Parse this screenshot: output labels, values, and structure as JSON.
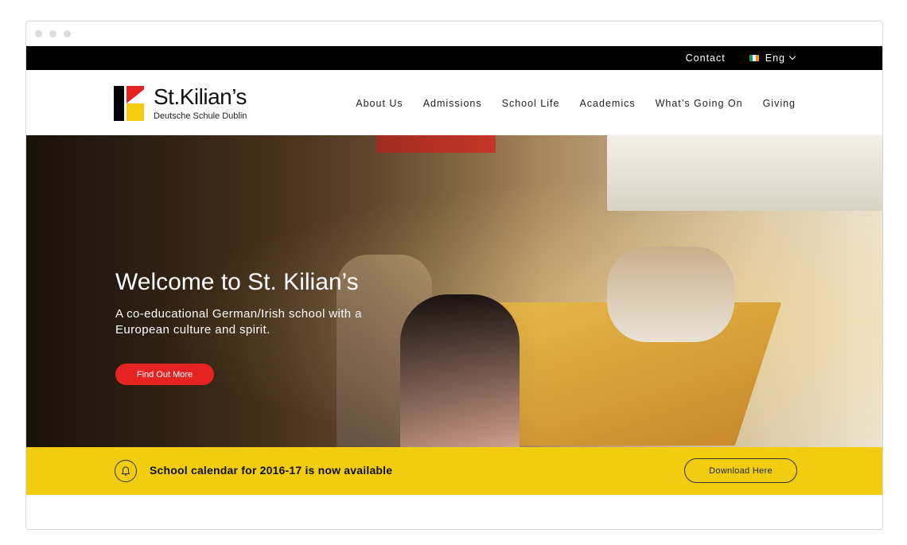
{
  "topbar": {
    "contact_label": "Contact",
    "language_label": "Eng",
    "flag_colors": [
      "#169b62",
      "#ffffff",
      "#ff883e"
    ]
  },
  "logo": {
    "name": "St.Kilian’s",
    "subtitle": "Deutsche Schule Dublin",
    "colors": {
      "black": "#000000",
      "red": "#e52421",
      "yellow": "#f5cd0f"
    }
  },
  "nav": {
    "items": [
      {
        "label": "About Us"
      },
      {
        "label": "Admissions"
      },
      {
        "label": "School Life"
      },
      {
        "label": "Academics"
      },
      {
        "label": "What’s Going On"
      },
      {
        "label": "Giving"
      }
    ]
  },
  "hero": {
    "title": "Welcome to St. Kilian’s",
    "subtitle": "A co-educational German/Irish school with a European culture and spirit.",
    "button_label": "Find Out More",
    "button_color": "#e52421"
  },
  "announcement": {
    "icon": "bell-icon",
    "text": "School calendar for 2016-17 is now available",
    "button_label": "Download Here",
    "background": "#f2cd0f"
  }
}
